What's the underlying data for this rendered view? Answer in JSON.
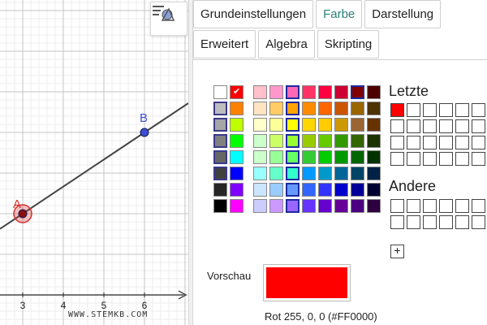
{
  "graphics": {
    "x_ticks": [
      "3",
      "4",
      "5",
      "6"
    ],
    "points": [
      {
        "label": "A",
        "x": 3,
        "y": 2,
        "color": "#d32f2f",
        "selected": true
      },
      {
        "label": "B",
        "x": 6,
        "y": 4,
        "color": "#3c4fd6",
        "selected": false
      }
    ],
    "line_color": "#444444",
    "watermark": "WWW.STEMKB.COM"
  },
  "tabs": {
    "row1": [
      "Grundeinstellungen",
      "Farbe",
      "Darstellung"
    ],
    "row2": [
      "Erweitert",
      "Algebra",
      "Skripting"
    ],
    "active": "Farbe"
  },
  "palette": {
    "greys": [
      [
        "#ffffff",
        "#ff0000"
      ],
      [
        "#bdbdbd",
        "#ff8000"
      ],
      [
        "#a6a6a6",
        "#c0ff00"
      ],
      [
        "#808080",
        "#00ff00"
      ],
      [
        "#666666",
        "#00ffff"
      ],
      [
        "#404040",
        "#0000ff"
      ],
      [
        "#262626",
        "#8000ff"
      ],
      [
        "#000000",
        "#ff00ff"
      ]
    ],
    "main": [
      [
        "#ffc0cb",
        "#ff99cc",
        "#ff69b4",
        "#ff3366",
        "#ff0040",
        "#cc0033",
        "#800000",
        "#4d0000"
      ],
      [
        "#ffe4c4",
        "#ffcc66",
        "#ffa500",
        "#ff8c00",
        "#ff6600",
        "#cc5500",
        "#996600",
        "#4d3300"
      ],
      [
        "#ffffcc",
        "#ffff99",
        "#ffff00",
        "#ffd700",
        "#ffcc00",
        "#cc9900",
        "#996633",
        "#663300"
      ],
      [
        "#ccffcc",
        "#ccff66",
        "#99ff33",
        "#99cc00",
        "#66cc00",
        "#339900",
        "#336600",
        "#1a3300"
      ],
      [
        "#ccffcc",
        "#99ff99",
        "#66ff66",
        "#33cc33",
        "#00cc00",
        "#009900",
        "#006600",
        "#003300"
      ],
      [
        "#99ffff",
        "#66ffcc",
        "#33ffcc",
        "#0099ff",
        "#0099cc",
        "#006699",
        "#004466",
        "#002244"
      ],
      [
        "#cce5ff",
        "#99ccff",
        "#6699ff",
        "#3366ff",
        "#3333ff",
        "#0000cc",
        "#000099",
        "#000033"
      ],
      [
        "#ccccff",
        "#cc99ff",
        "#9966ff",
        "#6633ff",
        "#6600cc",
        "#660099",
        "#4b0082",
        "#2e0040"
      ]
    ],
    "selected": "#ff0000"
  },
  "recent": {
    "title": "Letzte",
    "colors": [
      "#ff0000"
    ]
  },
  "other": {
    "title": "Andere",
    "plus": "+"
  },
  "preview": {
    "label": "Vorschau",
    "color": "#ff0000",
    "rgb_text": "Rot 255, 0, 0 (#FF0000)"
  }
}
